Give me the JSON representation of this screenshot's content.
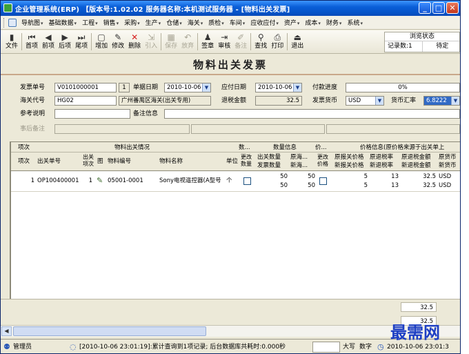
{
  "window": {
    "title": "企业管理系统(ERP) 【版本号:1.02.02 服务器名称:本机测试服务器 - [物料出关发票]",
    "controls": {
      "minimize": "_",
      "maximize": "□",
      "close": "✕"
    }
  },
  "menu": {
    "items": [
      {
        "label": "导航图",
        "arrow": "▾"
      },
      {
        "label": "基础数据",
        "arrow": "▾"
      },
      {
        "label": "工程",
        "arrow": "▾"
      },
      {
        "label": "销售",
        "arrow": "▾"
      },
      {
        "label": "采购",
        "arrow": "▾"
      },
      {
        "label": "生产",
        "arrow": "▾"
      },
      {
        "label": "仓储",
        "arrow": "▾"
      },
      {
        "label": "海关",
        "arrow": "▾"
      },
      {
        "label": "质检",
        "arrow": "▾"
      },
      {
        "label": "车间",
        "arrow": "▾"
      },
      {
        "label": "应收应付",
        "arrow": "▾"
      },
      {
        "label": "资产",
        "arrow": "▾"
      },
      {
        "label": "成本",
        "arrow": "▾"
      },
      {
        "label": "财务",
        "arrow": "▾"
      },
      {
        "label": "系统",
        "arrow": "▾"
      }
    ]
  },
  "toolbar": {
    "buttons": [
      {
        "label": "文件",
        "icon": "▮"
      },
      {
        "label": "首项",
        "icon": "⏮"
      },
      {
        "label": "前项",
        "icon": "◀"
      },
      {
        "label": "后项",
        "icon": "▶"
      },
      {
        "label": "尾项",
        "icon": "⏭"
      },
      {
        "label": "增加",
        "icon": "▢"
      },
      {
        "label": "修改",
        "icon": "✎"
      },
      {
        "label": "删除",
        "icon": "✕"
      },
      {
        "label": "引入",
        "icon": "⇲"
      },
      {
        "label": "保存",
        "icon": "▦"
      },
      {
        "label": "放弃",
        "icon": "↶"
      },
      {
        "label": "签章",
        "icon": "♟"
      },
      {
        "label": "审核",
        "icon": "⇥"
      },
      {
        "label": "备注",
        "icon": "✐"
      },
      {
        "label": "查找",
        "icon": "⚲"
      },
      {
        "label": "打印",
        "icon": "⎙"
      },
      {
        "label": "退出",
        "icon": "⏏"
      }
    ],
    "status_panel": {
      "title": "浏览状态",
      "records_label": "记录数:1",
      "state": "待定"
    }
  },
  "form": {
    "title": "物料出关发票",
    "invoice_no_label": "发票单号",
    "invoice_no": "V0101000001",
    "invoice_seq": "1",
    "doc_date_label": "单据日期",
    "doc_date": "2010-10-06",
    "due_date_label": "应付日期",
    "due_date": "2010-10-06",
    "pay_progress_label": "付款进度",
    "pay_progress": "0%",
    "customs_code_label": "海关代号",
    "customs_code": "HG02",
    "customs_name": "广州番禺区海关(出关专用)",
    "refund_amount_label": "退税金额",
    "refund_amount": "32.5",
    "currency_label": "发票货币",
    "currency": "USD",
    "rate_label": "货币汇率",
    "rate": "6.8222",
    "ref_note_label": "参考说明",
    "ref_note": "",
    "remark_label": "备注信息",
    "remark": "",
    "after_note_label": "事后备注",
    "after_note": ""
  },
  "grid": {
    "group_headers": {
      "seq": "项次",
      "material": "物料出关情况",
      "qty_group_short": "数...",
      "qty_info": "数量信息",
      "price_group_short": "价...",
      "price_info": "价格信息(原价格来源于出关单上"
    },
    "columns": {
      "seq": "项次",
      "out_no": "出关单号",
      "out_seq": "出关项次",
      "img": "图",
      "mat_no": "物料编号",
      "mat_name": "物料名称",
      "unit": "单位",
      "chg_qty": "更改数量",
      "out_qty": "出关数量",
      "inv_qty": "发票数量",
      "orig_cust": "原海...",
      "new_cust": "新海...",
      "chg_price": "更改价格",
      "orig_price": "原报关价格",
      "new_price": "新报关价格",
      "orig_rate": "原退税率",
      "new_rate": "新退税率",
      "orig_amt": "原退税金额",
      "new_amt": "新退税金额",
      "orig_cur": "原货币",
      "new_cur": "新货币"
    },
    "rows": [
      {
        "seq": "1",
        "out_no": "OP100400001",
        "out_seq": "1",
        "img": "✎",
        "mat_no": "05001-0001",
        "mat_name": "Sony电视遥控器(A型号",
        "unit": "个",
        "out_qty": "50",
        "inv_qty": "50",
        "orig_cust": "50",
        "new_cust": "50",
        "orig_price": "5",
        "new_price": "5",
        "orig_rate": "13",
        "new_rate": "13",
        "orig_amt": "32.5",
        "new_amt": "32.5",
        "orig_cur": "USD",
        "new_cur": "USD"
      }
    ],
    "totals": {
      "orig_amt": "32.5",
      "new_amt": "32.5"
    }
  },
  "statusbar": {
    "user": "管理员",
    "message": "[2010-10-06 23:01:19]:累计查询到1项记录; 后台数据库共耗时:0.000秒",
    "caps": "大写",
    "num": "数字",
    "clock": "2010-10-06 23:01:3"
  },
  "watermark": "最需网"
}
